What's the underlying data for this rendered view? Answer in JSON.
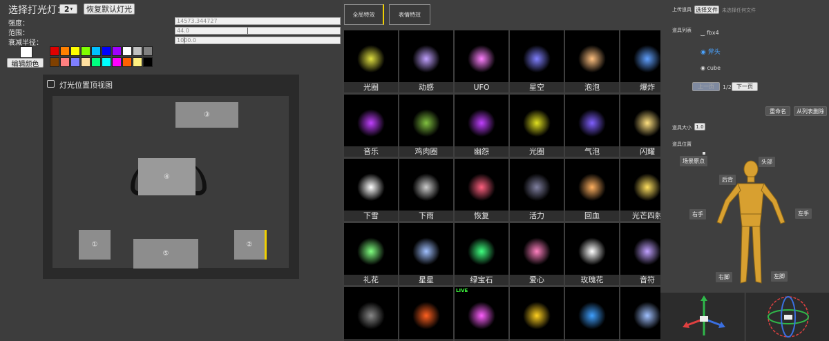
{
  "left": {
    "select_light_label": "选择打光灯：",
    "select_light_value": "2",
    "reset_button": "恢复默认灯光",
    "intensity_label": "强度：",
    "intensity_value": "14573.344727",
    "range_label": "范围：",
    "range_value": "44.0",
    "falloff_label": "衰减半径：",
    "falloff_value": "1000.0",
    "edit_color_button": "编辑颜色",
    "palette_row1": [
      "#e00000",
      "#ff8000",
      "#ffff00",
      "#80ff00",
      "#00c0ff",
      "#0000ff",
      "#a000ff",
      "#ffffff",
      "#c0c0c0",
      "#808080"
    ],
    "palette_row2": [
      "#804000",
      "#ff8080",
      "#8080ff",
      "#ffe0a0",
      "#00ff80",
      "#00ffff",
      "#ff00ff",
      "#ff6000",
      "#fff080",
      "#000000"
    ],
    "current_color": "#ffffff",
    "topview_title": "灯光位置顶视图",
    "lamps": [
      "③",
      "④",
      "①",
      "⑤",
      "②"
    ]
  },
  "mid": {
    "tabs": [
      "全局特效",
      "表情特效"
    ],
    "effects": [
      "光圈",
      "动感",
      "UFO",
      "星空",
      "泡泡",
      "爆炸",
      "音乐",
      "鸡肉圈",
      "幽怨",
      "光圈",
      "气泡",
      "闪耀",
      "下雪",
      "下雨",
      "恢复",
      "活力",
      "回血",
      "光芒四射",
      "礼花",
      "星星",
      "绿宝石",
      "爱心",
      "玫瑰花",
      "音符",
      "",
      "",
      "",
      "",
      "",
      ""
    ],
    "live_badge": "LIVE"
  },
  "right": {
    "upload_label": "上传道具",
    "choose_file_button": "选择文件",
    "no_file_text": "未选择任何文件",
    "prop_list_label": "道具列表",
    "props": [
      "fbx4",
      "斧头",
      "cube"
    ],
    "prev_button": "上一页",
    "page_text": "1/2",
    "next_button": "下一页",
    "rename_button": "重命名",
    "remove_button": "从列表删除",
    "size_label": "道具大小",
    "size_value": "1.0",
    "position_label": "道具位置",
    "origin_button": "场景原点",
    "body_parts": [
      "头部",
      "后背",
      "右手",
      "左手",
      "右脚",
      "左脚"
    ],
    "accent": "#4aa3ff"
  }
}
